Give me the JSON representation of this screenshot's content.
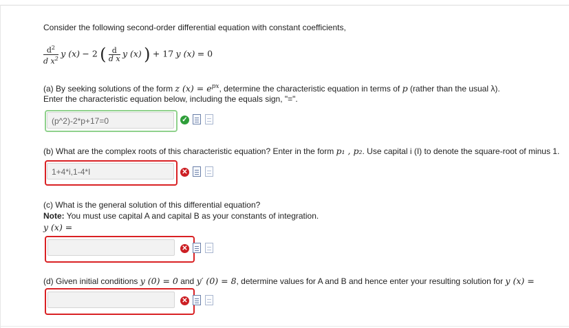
{
  "intro": "Consider the following second-order differential equation with constant coefficients,",
  "equation": {
    "d2": "d",
    "sq": "2",
    "dx2": "d x",
    "sq2": "2",
    "y_of_x_1": "y (x)",
    "minus_two": "− 2",
    "d1": "d",
    "dx1": "d x",
    "y_of_x_2": "y (x)",
    "plus17": "+ 17",
    "y_of_x_3": "y (x)",
    "eq0": "= 0"
  },
  "part_a": {
    "line1_pre": "(a) By seeking solutions of the form ",
    "line1_math": "z (x) = e",
    "line1_sup": "px",
    "line1_post": ", determine the characteristic equation in terms of ",
    "line1_p": "p",
    "line1_end": " (rather than the usual λ).",
    "line2": "Enter the characteristic equation below, including the equals sign, \"=\".",
    "answer": "(p^2)-2*p+17=0",
    "status": "correct"
  },
  "part_b": {
    "line_pre": "(b) What are the complex roots of this characteristic equation? Enter in the form ",
    "line_math": "p₁ , p₂",
    "line_post": ". Use capital i (I) to denote the square-root of minus 1.",
    "answer": "1+4*i,1-4*I",
    "status": "incorrect"
  },
  "part_c": {
    "line1": "(c) What is the general solution of this differential equation?",
    "note_label": "Note:",
    "note_text": " You must use capital A and capital B as your constants of integration.",
    "lhs": "y (x) =",
    "answer": "",
    "status": "incorrect"
  },
  "part_d": {
    "line_pre": "(d) Given initial conditions ",
    "cond1": "y (0) = 0",
    "and": " and ",
    "cond2": "y′ (0) = 8",
    "line_post": ", determine values for A and B and hence enter your resulting solution for ",
    "line_end": "y (x) =",
    "answer": "",
    "status": "incorrect"
  },
  "icons": {
    "correct": "check-circle-icon",
    "incorrect": "cross-circle-icon",
    "preview": "preview-icon",
    "help": "help-icon"
  },
  "colors": {
    "correct_border": "#8fd18c",
    "incorrect_border": "#d92023",
    "correct_icon": "#2f9e3a",
    "incorrect_icon": "#cc1f24"
  }
}
